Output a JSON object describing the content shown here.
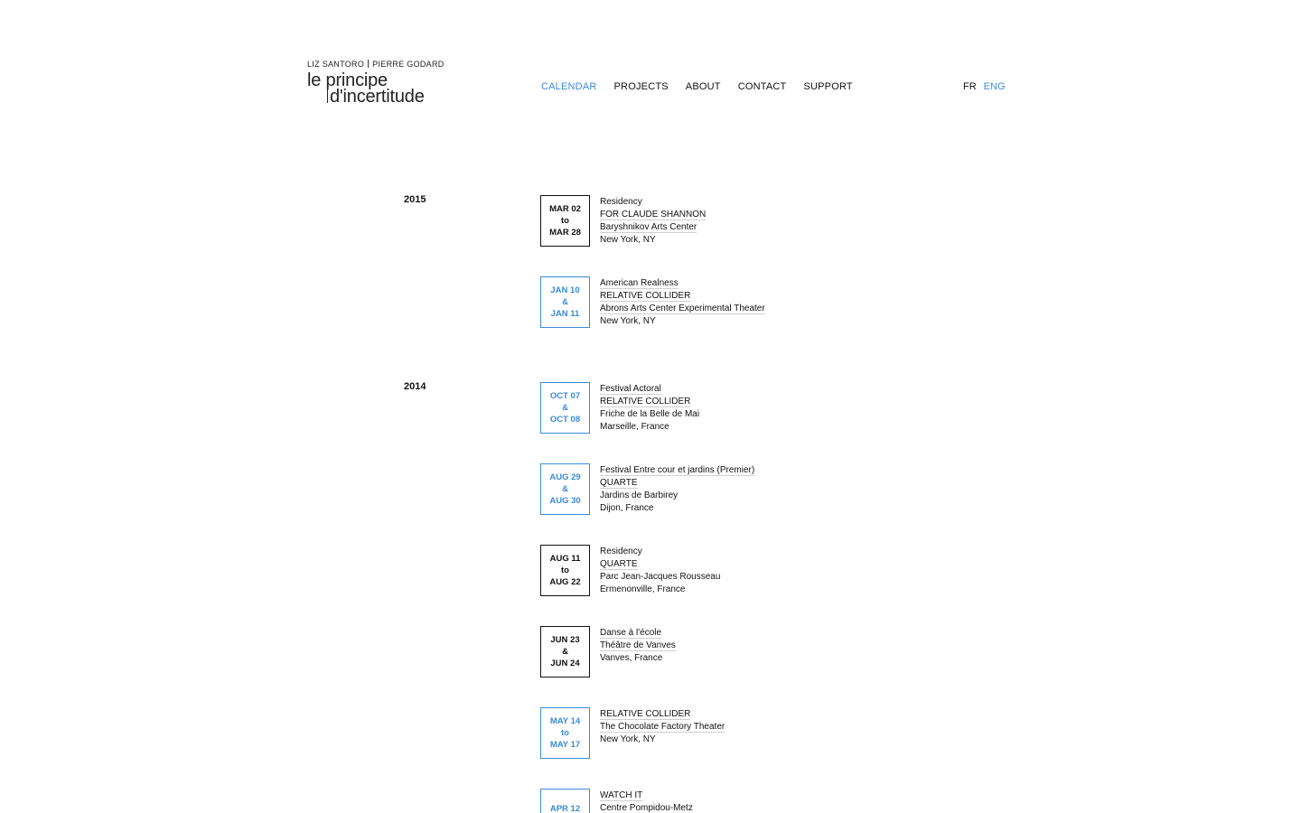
{
  "header": {
    "names_left": "LIZ SANTORO",
    "names_right": "PIERRE GODARD",
    "logo_line1": "le principe",
    "logo_line2": "d'incertitude"
  },
  "nav": {
    "items": [
      {
        "label": "CALENDAR",
        "active": true
      },
      {
        "label": "PROJECTS",
        "active": false
      },
      {
        "label": "ABOUT",
        "active": false
      },
      {
        "label": "CONTACT",
        "active": false
      },
      {
        "label": "SUPPORT",
        "active": false
      }
    ]
  },
  "lang": {
    "items": [
      {
        "label": "FR",
        "active": false
      },
      {
        "label": "ENG",
        "active": true
      }
    ]
  },
  "colors": {
    "accent": "#3a8bd6",
    "text": "#111111",
    "background": "#ffffff"
  },
  "years": [
    "2015",
    "2014"
  ],
  "events": [
    {
      "date1": "MAR 02",
      "conn": "to",
      "date2": "MAR 28",
      "blue": false,
      "lines": [
        "Residency",
        "FOR CLAUDE SHANNON",
        "Baryshnikov Arts Center",
        "New York, NY"
      ]
    },
    {
      "date1": "JAN 10",
      "conn": "&",
      "date2": "JAN 11",
      "blue": true,
      "lines": [
        "American Realness",
        "RELATIVE COLLIDER",
        "Abrons Arts Center Experimental Theater",
        "New York, NY"
      ]
    },
    {
      "date1": "OCT 07",
      "conn": "&",
      "date2": "OCT 08",
      "blue": true,
      "lines": [
        "Festival Actoral",
        "RELATIVE COLLIDER",
        "Friche de la Belle de Mai",
        "Marseille, France"
      ]
    },
    {
      "date1": "AUG 29",
      "conn": "&",
      "date2": "AUG 30",
      "blue": true,
      "lines": [
        "Festival Entre cour et jardins (Premier)",
        "QUARTE",
        "Jardins de Barbirey",
        "Dijon, France"
      ]
    },
    {
      "date1": "AUG 11",
      "conn": "to",
      "date2": "AUG 22",
      "blue": false,
      "lines": [
        "Residency",
        "QUARTE",
        "Parc Jean-Jacques Rousseau",
        "Ermenonville, France"
      ]
    },
    {
      "date1": "JUN 23",
      "conn": "&",
      "date2": "JUN 24",
      "blue": false,
      "lines": [
        "Danse à l'école",
        "Théâtre de Vanves",
        "Vanves, France"
      ]
    },
    {
      "date1": "MAY 14",
      "conn": "to",
      "date2": "MAY 17",
      "blue": true,
      "lines": [
        "RELATIVE COLLIDER",
        "The Chocolate Factory Theater",
        "New York, NY"
      ]
    },
    {
      "date1": "APR 12",
      "conn": "&",
      "date2": "",
      "blue": true,
      "lines": [
        "WATCH IT",
        "Centre Pompidou-Metz"
      ]
    }
  ]
}
